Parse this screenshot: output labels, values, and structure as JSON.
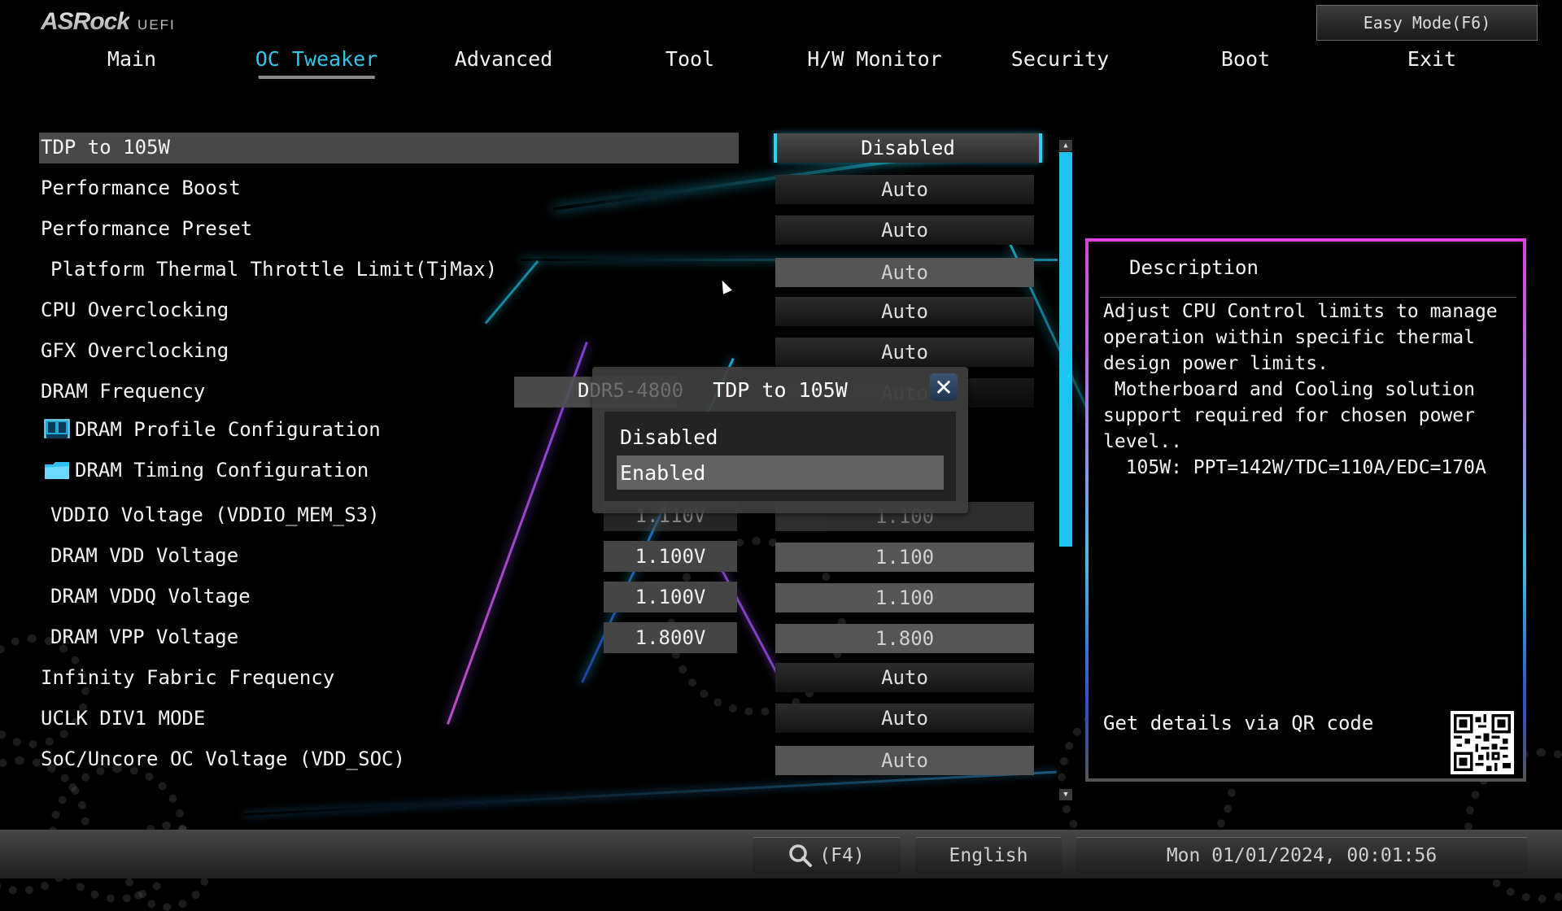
{
  "app": {
    "brand": "ASRock",
    "sub": "UEFI"
  },
  "header": {
    "easy_mode_label": "Easy Mode(F6)"
  },
  "tabs": [
    {
      "label": "Main",
      "active": false
    },
    {
      "label": "OC Tweaker",
      "active": true
    },
    {
      "label": "Advanced",
      "active": false
    },
    {
      "label": "Tool",
      "active": false
    },
    {
      "label": "H/W Monitor",
      "active": false
    },
    {
      "label": "Security",
      "active": false
    },
    {
      "label": "Boot",
      "active": false
    },
    {
      "label": "Exit",
      "active": false
    }
  ],
  "settings": [
    {
      "label": "TDP to 105W",
      "value": "Disabled",
      "selected": true
    },
    {
      "label": "Performance Boost",
      "value": "Auto"
    },
    {
      "label": "Performance Preset",
      "value": "Auto"
    },
    {
      "label": "Platform Thermal Throttle Limit(TjMax)",
      "value": "Auto",
      "indent": true
    },
    {
      "label": "CPU Overclocking",
      "value": "Auto"
    },
    {
      "label": "GFX Overclocking",
      "value": "Auto"
    },
    {
      "label": "DRAM Frequency",
      "current": "DDR5-4800",
      "value": "Auto"
    },
    {
      "label": "DRAM Profile Configuration",
      "icon": "memory-icon"
    },
    {
      "label": "DRAM Timing Configuration",
      "icon": "folder-icon"
    },
    {
      "label": "VDDIO Voltage (VDDIO_MEM_S3)",
      "current": "1.110V",
      "value": "1.100",
      "indent": true
    },
    {
      "label": "DRAM VDD Voltage",
      "current": "1.100V",
      "value": "1.100",
      "indent": true
    },
    {
      "label": "DRAM VDDQ Voltage",
      "current": "1.100V",
      "value": "1.100",
      "indent": true
    },
    {
      "label": "DRAM VPP Voltage",
      "current": "1.800V",
      "value": "1.800",
      "indent": true
    },
    {
      "label": "Infinity Fabric Frequency",
      "value": "Auto"
    },
    {
      "label": "UCLK DIV1 MODE",
      "value": "Auto"
    },
    {
      "label": "SoC/Uncore OC Voltage (VDD_SOC)",
      "value": "Auto"
    }
  ],
  "description": {
    "title": "Description",
    "body": "Adjust CPU Control limits to manage\noperation within specific thermal\ndesign power limits.\n Motherboard and Cooling solution\nsupport required for chosen power\nlevel..\n  105W: PPT=142W/TDC=110A/EDC=170A",
    "qr_label": "Get details via QR code"
  },
  "popup": {
    "title": "TDP to 105W",
    "options": [
      "Disabled",
      "Enabled"
    ],
    "highlighted_index": 1
  },
  "bottom": {
    "search_label": "(F4)",
    "language": "English",
    "datetime": "Mon 01/01/2024, 00:01:56"
  },
  "colors": {
    "accent": "#1fc3ef",
    "active_tab": "#2fc6ea",
    "panel_border": "#e040e0"
  }
}
